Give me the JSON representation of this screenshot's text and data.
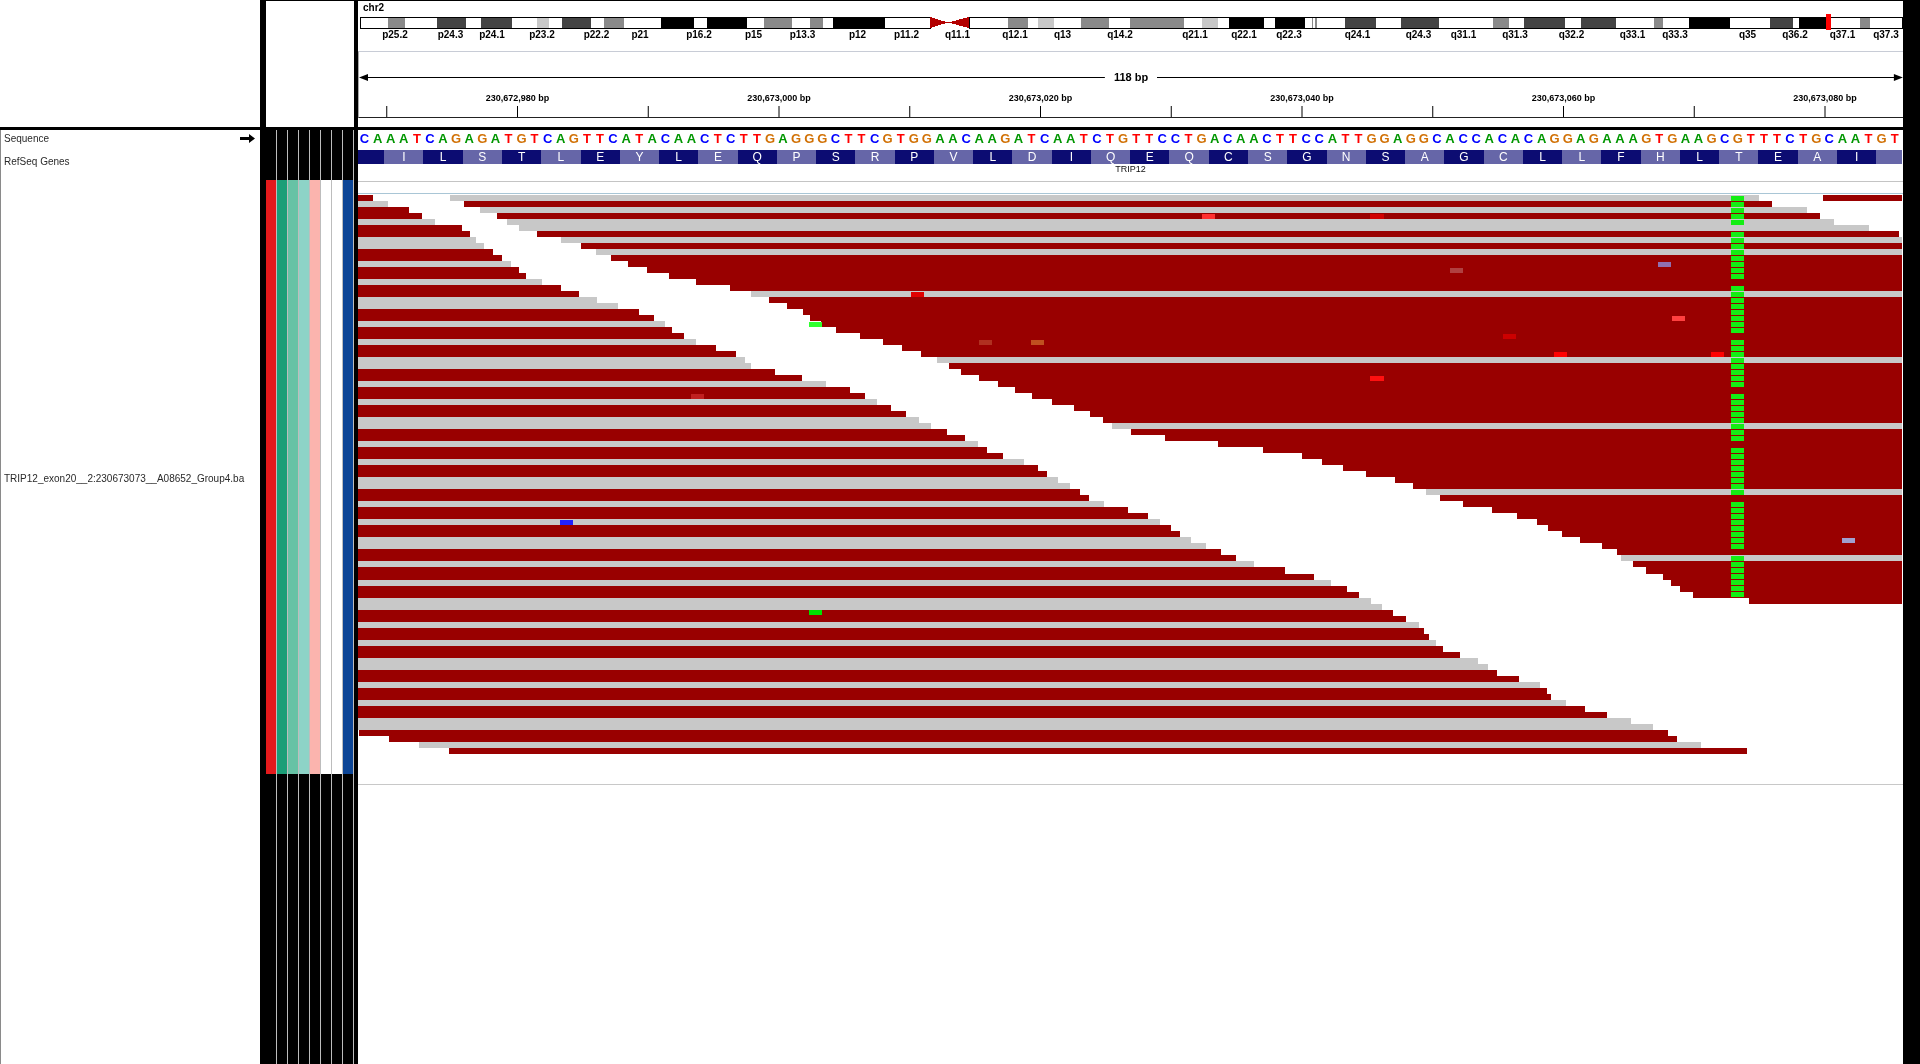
{
  "ideogram": {
    "chromosome": "chr2",
    "band_labels": [
      "p25.2",
      "p24.3",
      "p24.1",
      "p23.2",
      "p22.2",
      "p21",
      "p16.2",
      "p15",
      "p13.3",
      "p12",
      "p11.2",
      "q11.1",
      "q12.1",
      "q13",
      "q14.2",
      "q21.1",
      "q22.1",
      "q22.3",
      "q24.1",
      "q24.3",
      "q31.1",
      "q31.3",
      "q32.2",
      "q33.1",
      "q33.3",
      "q35",
      "q36.2",
      "q37.1",
      "q37.3"
    ]
  },
  "ruler": {
    "span": "118 bp",
    "ticks": [
      "230,672,980 bp",
      "230,673,000 bp",
      "230,673,020 bp",
      "230,673,040 bp",
      "230,673,060 bp",
      "230,673,080 bp"
    ]
  },
  "tracks": [
    {
      "kind": "sequence",
      "name": "Sequence",
      "bases": [
        {
          "base": "C",
          "color": "#0000ff"
        },
        {
          "base": "A",
          "color": "#009600"
        },
        {
          "base": "A",
          "color": "#009600"
        },
        {
          "base": "A",
          "color": "#009600"
        },
        {
          "base": "T",
          "color": "#ff0000"
        },
        {
          "base": "C",
          "color": "#0000ff"
        },
        {
          "base": "A",
          "color": "#009600"
        },
        {
          "base": "G",
          "color": "#d17105"
        },
        {
          "base": "A",
          "color": "#009600"
        },
        {
          "base": "G",
          "color": "#d17105"
        },
        {
          "base": "A",
          "color": "#009600"
        },
        {
          "base": "T",
          "color": "#ff0000"
        },
        {
          "base": "G",
          "color": "#d17105"
        },
        {
          "base": "T",
          "color": "#ff0000"
        },
        {
          "base": "C",
          "color": "#0000ff"
        },
        {
          "base": "A",
          "color": "#009600"
        },
        {
          "base": "G",
          "color": "#d17105"
        },
        {
          "base": "T",
          "color": "#ff0000"
        },
        {
          "base": "T",
          "color": "#ff0000"
        },
        {
          "base": "C",
          "color": "#0000ff"
        },
        {
          "base": "A",
          "color": "#009600"
        },
        {
          "base": "T",
          "color": "#ff0000"
        },
        {
          "base": "A",
          "color": "#009600"
        },
        {
          "base": "C",
          "color": "#0000ff"
        },
        {
          "base": "A",
          "color": "#009600"
        },
        {
          "base": "A",
          "color": "#009600"
        },
        {
          "base": "C",
          "color": "#0000ff"
        },
        {
          "base": "T",
          "color": "#ff0000"
        },
        {
          "base": "C",
          "color": "#0000ff"
        },
        {
          "base": "T",
          "color": "#ff0000"
        },
        {
          "base": "T",
          "color": "#ff0000"
        },
        {
          "base": "G",
          "color": "#d17105"
        },
        {
          "base": "A",
          "color": "#009600"
        },
        {
          "base": "G",
          "color": "#d17105"
        },
        {
          "base": "G",
          "color": "#d17105"
        },
        {
          "base": "G",
          "color": "#d17105"
        },
        {
          "base": "C",
          "color": "#0000ff"
        },
        {
          "base": "T",
          "color": "#ff0000"
        },
        {
          "base": "T",
          "color": "#ff0000"
        },
        {
          "base": "C",
          "color": "#0000ff"
        },
        {
          "base": "G",
          "color": "#d17105"
        },
        {
          "base": "T",
          "color": "#ff0000"
        },
        {
          "base": "G",
          "color": "#d17105"
        },
        {
          "base": "G",
          "color": "#d17105"
        },
        {
          "base": "A",
          "color": "#009600"
        },
        {
          "base": "A",
          "color": "#009600"
        },
        {
          "base": "C",
          "color": "#0000ff"
        },
        {
          "base": "A",
          "color": "#009600"
        },
        {
          "base": "A",
          "color": "#009600"
        },
        {
          "base": "G",
          "color": "#d17105"
        },
        {
          "base": "A",
          "color": "#009600"
        },
        {
          "base": "T",
          "color": "#ff0000"
        },
        {
          "base": "C",
          "color": "#0000ff"
        },
        {
          "base": "A",
          "color": "#009600"
        },
        {
          "base": "A",
          "color": "#009600"
        },
        {
          "base": "T",
          "color": "#ff0000"
        },
        {
          "base": "C",
          "color": "#0000ff"
        },
        {
          "base": "T",
          "color": "#ff0000"
        },
        {
          "base": "G",
          "color": "#d17105"
        },
        {
          "base": "T",
          "color": "#ff0000"
        },
        {
          "base": "T",
          "color": "#ff0000"
        },
        {
          "base": "C",
          "color": "#0000ff"
        },
        {
          "base": "C",
          "color": "#0000ff"
        },
        {
          "base": "T",
          "color": "#ff0000"
        },
        {
          "base": "G",
          "color": "#d17105"
        },
        {
          "base": "A",
          "color": "#009600"
        },
        {
          "base": "C",
          "color": "#0000ff"
        },
        {
          "base": "A",
          "color": "#009600"
        },
        {
          "base": "A",
          "color": "#009600"
        },
        {
          "base": "C",
          "color": "#0000ff"
        },
        {
          "base": "T",
          "color": "#ff0000"
        },
        {
          "base": "T",
          "color": "#ff0000"
        },
        {
          "base": "C",
          "color": "#0000ff"
        },
        {
          "base": "C",
          "color": "#0000ff"
        },
        {
          "base": "A",
          "color": "#009600"
        },
        {
          "base": "T",
          "color": "#ff0000"
        },
        {
          "base": "T",
          "color": "#ff0000"
        },
        {
          "base": "G",
          "color": "#d17105"
        },
        {
          "base": "G",
          "color": "#d17105"
        },
        {
          "base": "A",
          "color": "#009600"
        },
        {
          "base": "G",
          "color": "#d17105"
        },
        {
          "base": "G",
          "color": "#d17105"
        },
        {
          "base": "C",
          "color": "#0000ff"
        },
        {
          "base": "A",
          "color": "#009600"
        },
        {
          "base": "C",
          "color": "#0000ff"
        },
        {
          "base": "C",
          "color": "#0000ff"
        },
        {
          "base": "A",
          "color": "#009600"
        },
        {
          "base": "C",
          "color": "#0000ff"
        },
        {
          "base": "A",
          "color": "#009600"
        },
        {
          "base": "C",
          "color": "#0000ff"
        },
        {
          "base": "A",
          "color": "#009600"
        },
        {
          "base": "G",
          "color": "#d17105"
        },
        {
          "base": "G",
          "color": "#d17105"
        },
        {
          "base": "A",
          "color": "#009600"
        },
        {
          "base": "G",
          "color": "#d17105"
        },
        {
          "base": "A",
          "color": "#009600"
        },
        {
          "base": "A",
          "color": "#009600"
        },
        {
          "base": "A",
          "color": "#009600"
        },
        {
          "base": "G",
          "color": "#d17105"
        },
        {
          "base": "T",
          "color": "#ff0000"
        },
        {
          "base": "G",
          "color": "#d17105"
        },
        {
          "base": "A",
          "color": "#009600"
        },
        {
          "base": "A",
          "color": "#009600"
        },
        {
          "base": "G",
          "color": "#d17105"
        },
        {
          "base": "C",
          "color": "#0000ff"
        },
        {
          "base": "G",
          "color": "#d17105"
        },
        {
          "base": "T",
          "color": "#ff0000"
        },
        {
          "base": "T",
          "color": "#ff0000"
        },
        {
          "base": "T",
          "color": "#ff0000"
        },
        {
          "base": "C",
          "color": "#0000ff"
        },
        {
          "base": "T",
          "color": "#ff0000"
        },
        {
          "base": "G",
          "color": "#d17105"
        },
        {
          "base": "C",
          "color": "#0000ff"
        },
        {
          "base": "A",
          "color": "#009600"
        },
        {
          "base": "A",
          "color": "#009600"
        },
        {
          "base": "T",
          "color": "#ff0000"
        },
        {
          "base": "G",
          "color": "#d17105"
        },
        {
          "base": "T",
          "color": "#ff0000"
        }
      ]
    },
    {
      "kind": "gene",
      "name": "RefSeq Genes",
      "amino_acids": [
        "I",
        "L",
        "S",
        "T",
        "L",
        "E",
        "Y",
        "L",
        "E",
        "Q",
        "P",
        "S",
        "R",
        "P",
        "V",
        "L",
        "D",
        "I",
        "Q",
        "E",
        "Q",
        "C",
        "S",
        "G",
        "N",
        "S",
        "A",
        "G",
        "C",
        "L",
        "L",
        "F",
        "H",
        "L",
        "T",
        "E",
        "A",
        "I"
      ],
      "gene": "TRIP12"
    },
    {
      "kind": "alignment",
      "name": "TRIP12_exon20__2:230673073__A08652_Group4.ba",
      "attributes": [
        {
          "color": "#e41a1c"
        },
        {
          "color": "#1b9e77"
        },
        {
          "color": "#66c2a5"
        },
        {
          "color": "#8dd3c7"
        },
        {
          "color": "#fbb4ae"
        },
        {
          "color": "#ffffff"
        },
        {
          "color": "#ffffff"
        },
        {
          "color": "#0c4596"
        }
      ]
    }
  ]
}
